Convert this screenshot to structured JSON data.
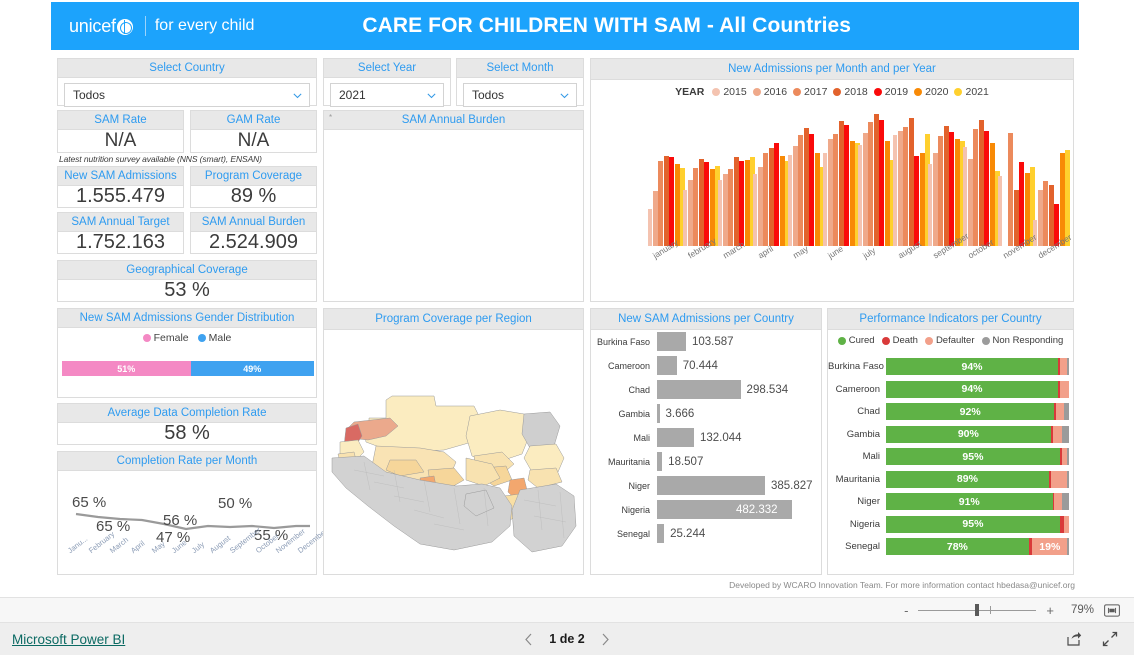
{
  "header": {
    "brand": "unicef",
    "tagline": "for every child",
    "title": "CARE FOR CHILDREN WITH SAM - All Countries",
    "banner_color": "#1CA3FC"
  },
  "slicers": [
    {
      "name": "country",
      "label": "Select Country",
      "value": "Todos"
    },
    {
      "name": "year",
      "label": "Select Year",
      "value": "2021"
    },
    {
      "name": "month",
      "label": "Select Month",
      "value": "Todos"
    }
  ],
  "cards": [
    {
      "name": "sam-rate",
      "label": "SAM Rate",
      "value": "N/A"
    },
    {
      "name": "gam-rate",
      "label": "GAM Rate",
      "value": "N/A"
    },
    {
      "name": "new-sam-admissions",
      "label": "New SAM Admissions",
      "value": "1.555.479"
    },
    {
      "name": "program-coverage",
      "label": "Program Coverage",
      "value": "89 %"
    },
    {
      "name": "sam-annual-target",
      "label": "SAM Annual Target",
      "value": "1.752.163"
    },
    {
      "name": "sam-annual-burden",
      "label": "SAM Annual Burden",
      "value": "2.524.909"
    },
    {
      "name": "geographical-coverage",
      "label": "Geographical Coverage",
      "value": "53 %"
    },
    {
      "name": "avg-data-completion",
      "label": "Average Data Completion Rate",
      "value": "58 %"
    }
  ],
  "survey_note": "Latest nutrition survey available (NNS (smart), ENSAN)",
  "panels": {
    "sam_annual_burden_empty": {
      "title": "SAM Annual Burden",
      "marker": "*"
    },
    "gender": {
      "title": "New SAM Admissions Gender Distribution"
    },
    "completion": {
      "title": "Completion Rate per Month"
    },
    "map": {
      "title": "Program Coverage per Region"
    },
    "admissions_month_year": {
      "title": "New Admissions per Month and per Year"
    },
    "admissions_country": {
      "title": "New SAM Admissions per Country"
    },
    "performance": {
      "title": "Performance Indicators per Country"
    }
  },
  "chart_data": [
    {
      "name": "admissions_month_year",
      "type": "bar",
      "title": "New Admissions per Month and per Year",
      "legend_title": "YEAR",
      "legend_position": "top",
      "xlabel": "",
      "ylabel": "",
      "grid": false,
      "categories": [
        "january",
        "february",
        "march",
        "april",
        "may",
        "june",
        "july",
        "august",
        "september",
        "october",
        "november",
        "december"
      ],
      "series": [
        {
          "name": "2015",
          "color": "#F4C3B0",
          "values": [
            32,
            48,
            57,
            62,
            78,
            80,
            87,
            95,
            70,
            85,
            60,
            22
          ]
        },
        {
          "name": "2016",
          "color": "#EFA98A",
          "values": [
            47,
            57,
            62,
            68,
            86,
            92,
            97,
            99,
            80,
            75,
            0,
            48
          ]
        },
        {
          "name": "2017",
          "color": "#EC8A5C",
          "values": [
            73,
            67,
            66,
            80,
            95,
            96,
            106,
            102,
            94,
            100,
            97,
            56
          ]
        },
        {
          "name": "2018",
          "color": "#E2622C",
          "values": [
            77,
            75,
            76,
            84,
            101,
            107,
            113,
            110,
            103,
            108,
            48,
            52
          ]
        },
        {
          "name": "2019",
          "color": "#FA0A0A",
          "values": [
            76,
            72,
            73,
            88,
            96,
            104,
            108,
            77,
            98,
            99,
            72,
            36
          ]
        },
        {
          "name": "2020",
          "color": "#F88A06",
          "values": [
            70,
            66,
            74,
            77,
            80,
            90,
            90,
            80,
            92,
            88,
            63,
            80
          ]
        },
        {
          "name": "2021",
          "color": "#FFD02E",
          "values": [
            67,
            69,
            76,
            73,
            68,
            88,
            74,
            96,
            90,
            64,
            68,
            82
          ]
        }
      ]
    },
    {
      "name": "completion_rate_per_month",
      "type": "line",
      "title": "Completion Rate per Month",
      "categories": [
        "Janu...",
        "February",
        "March",
        "April",
        "May",
        "June",
        "July",
        "August",
        "September",
        "October",
        "November",
        "December"
      ],
      "values": [
        65,
        65,
        62,
        60,
        56,
        47,
        53,
        52,
        50,
        48,
        55,
        52
      ],
      "labels": [
        {
          "text": "65 %",
          "index": 0
        },
        {
          "text": "65 %",
          "index": 1
        },
        {
          "text": "56 %",
          "index": 4
        },
        {
          "text": "47 %",
          "index": 5
        },
        {
          "text": "50 %",
          "index": 8
        },
        {
          "text": "55 %",
          "index": 10
        }
      ],
      "line_color": "#9a9a9a"
    },
    {
      "name": "gender_distribution",
      "type": "bar",
      "title": "New SAM Admissions Gender Distribution",
      "categories": [
        "Female",
        "Male"
      ],
      "values": [
        51,
        49
      ],
      "value_labels": [
        "51%",
        "49%"
      ],
      "colors": [
        "#F489C4",
        "#3FA2F0"
      ]
    },
    {
      "name": "admissions_per_country",
      "type": "bar",
      "title": "New SAM Admissions per Country",
      "orientation": "horizontal",
      "bar_color": "#a9a9a9",
      "categories": [
        "Burkina Faso",
        "Cameroon",
        "Chad",
        "Gambia",
        "Mali",
        "Mauritania",
        "Niger",
        "Nigeria",
        "Senegal"
      ],
      "values": [
        103587,
        70444,
        298534,
        3666,
        132044,
        18507,
        385827,
        482332,
        25244
      ],
      "value_labels": [
        "103.587",
        "70.444",
        "298.534",
        "3.666",
        "132.044",
        "18.507",
        "385.827",
        "482.332",
        "25.244"
      ]
    },
    {
      "name": "performance_indicators",
      "type": "bar",
      "title": "Performance Indicators per Country",
      "orientation": "horizontal",
      "stacked": true,
      "legend": [
        {
          "name": "Cured",
          "color": "#5FB246"
        },
        {
          "name": "Death",
          "color": "#D93A3A"
        },
        {
          "name": "Defaulter",
          "color": "#F2A08A"
        },
        {
          "name": "Non Responding",
          "color": "#9B9B9B"
        }
      ],
      "categories": [
        "Burkina Faso",
        "Cameroon",
        "Chad",
        "Gambia",
        "Mali",
        "Mauritania",
        "Niger",
        "Nigeria",
        "Senegal"
      ],
      "series": [
        {
          "name": "Cured",
          "values": [
            94,
            94,
            92,
            90,
            95,
            89,
            91,
            95,
            78
          ]
        },
        {
          "name": "Death",
          "values": [
            1,
            1,
            1,
            1,
            1,
            1,
            1,
            2,
            2
          ]
        },
        {
          "name": "Defaulter",
          "values": [
            4,
            5,
            4,
            5,
            3,
            9,
            4,
            3,
            19
          ]
        },
        {
          "name": "Non Responding",
          "values": [
            1,
            0,
            3,
            4,
            1,
            1,
            4,
            0,
            1
          ]
        }
      ],
      "cured_labels": [
        "94%",
        "94%",
        "92%",
        "90%",
        "95%",
        "89%",
        "91%",
        "95%",
        "78%"
      ],
      "extra_labels": [
        {
          "category": "Senegal",
          "series": "Defaulter",
          "text": "19%"
        }
      ]
    }
  ],
  "credit": {
    "text": "Developed by WCARO Innovation Team. For more information contact ",
    "email": "hbedasa@unicef.org"
  },
  "statusbar": {
    "zoom_out": "-",
    "zoom_in": "+",
    "zoom_level": "79%",
    "fit_icon": "fit-to-page-icon"
  },
  "bottombar": {
    "powerbi_label": "Microsoft Power BI",
    "prev_icon": "chevron-left-icon",
    "next_icon": "chevron-right-icon",
    "page_indicator": "1 de 2",
    "share_icon": "share-icon",
    "fullscreen_icon": "fullscreen-icon"
  }
}
